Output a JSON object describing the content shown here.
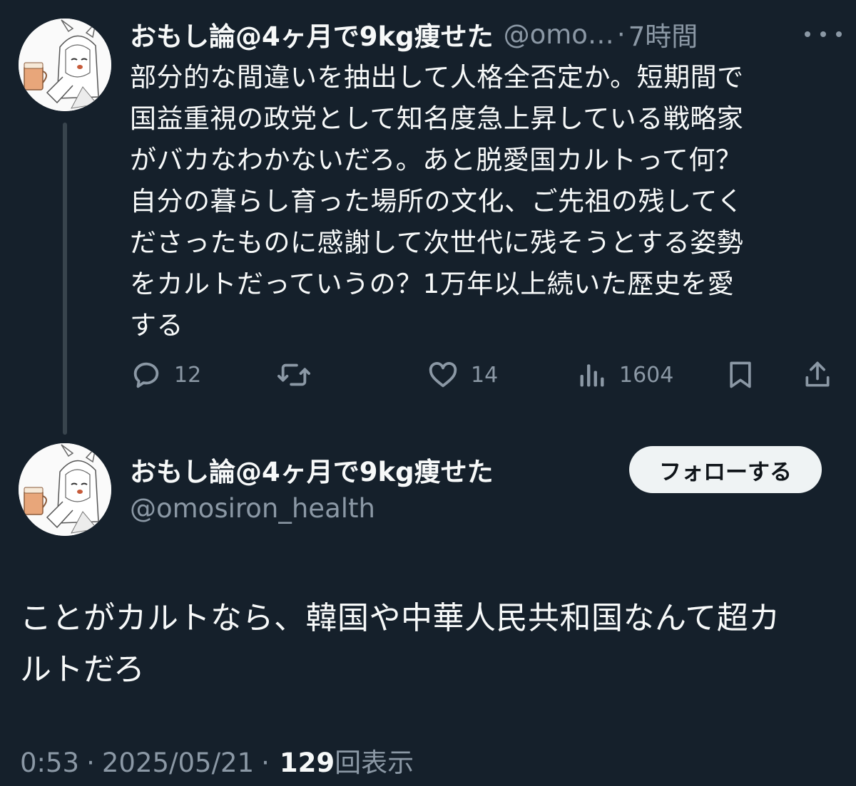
{
  "tweet1": {
    "display_name": "おもし論@4ヶ月で9kg痩せた",
    "handle": "@omo…",
    "separator": "·",
    "time": "7時間",
    "more_icon": "more-dots-icon",
    "body_lines": [
      "部分的な間違いを抽出して人格全否定か。短期間で",
      "国益重視の政党として知名度急上昇している戦略家",
      "がバカなわかないだろ。あと脱愛国カルトって何？",
      "自分の暮らし育った場所の文化、ご先祖の残してく",
      "ださったものに感謝して次世代に残そうとする姿勢",
      "をカルトだっていうの？1万年以上続いた歴史を愛",
      "する"
    ],
    "actions": {
      "reply": {
        "icon": "reply-icon",
        "count": "12"
      },
      "retweet": {
        "icon": "retweet-icon",
        "count": ""
      },
      "like": {
        "icon": "heart-icon",
        "count": "14"
      },
      "views": {
        "icon": "analytics-icon",
        "count": "1604"
      },
      "bookmark": {
        "icon": "bookmark-icon"
      },
      "share": {
        "icon": "share-icon"
      }
    }
  },
  "tweet2": {
    "display_name": "おもし論@4ヶ月で9kg痩せた",
    "handle": "@omosiron_health",
    "follow_label": "フォローする",
    "body_lines": [
      "ことがカルトなら、韓国や中華人民共和国なんて超カ",
      "ルトだろ"
    ],
    "time": "0:53",
    "separator": "·",
    "date": "2025/05/21",
    "views_count": "129",
    "views_label": "回表示"
  },
  "colors": {
    "background": "#15202b",
    "text": "#f7f9f9",
    "muted": "#8b98a5",
    "thread_line": "#38444d",
    "follow_bg": "#eff3f4"
  }
}
